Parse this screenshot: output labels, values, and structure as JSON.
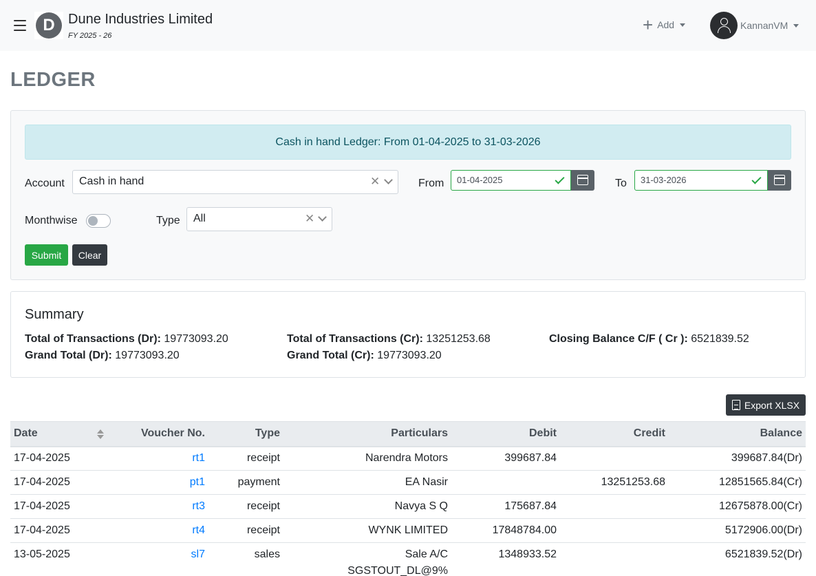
{
  "header": {
    "logo_letter": "D",
    "company_name": "Dune Industries Limited",
    "fiscal_year": "FY 2025 - 26",
    "add_label": "Add",
    "username": "KannanVM"
  },
  "page": {
    "title": "LEDGER"
  },
  "filter": {
    "info_message": "Cash in hand Ledger: From 01-04-2025 to 31-03-2026",
    "account_label": "Account",
    "account_value": "Cash in hand",
    "from_label": "From",
    "from_value": "01-04-2025",
    "to_label": "To",
    "to_value": "31-03-2026",
    "monthwise_label": "Monthwise",
    "monthwise_on": false,
    "type_label": "Type",
    "type_value": "All",
    "submit_label": "Submit",
    "clear_label": "Clear"
  },
  "summary": {
    "title": "Summary",
    "total_dr_label": "Total of Transactions (Dr):",
    "total_dr_value": "19773093.20",
    "grand_dr_label": "Grand Total (Dr):",
    "grand_dr_value": "19773093.20",
    "total_cr_label": "Total of Transactions (Cr):",
    "total_cr_value": "13251253.68",
    "grand_cr_label": "Grand Total (Cr):",
    "grand_cr_value": "19773093.20",
    "closing_label": "Closing Balance C/F ( Cr ):",
    "closing_value": "6521839.52"
  },
  "export": {
    "label": "Export XLSX"
  },
  "table": {
    "headers": {
      "date": "Date",
      "voucher": "Voucher No.",
      "type": "Type",
      "particulars": "Particulars",
      "debit": "Debit",
      "credit": "Credit",
      "balance": "Balance"
    },
    "rows": [
      {
        "date": "17-04-2025",
        "voucher": "rt1",
        "type": "receipt",
        "particulars": "Narendra Motors",
        "particulars2": "",
        "debit": "399687.84",
        "credit": "",
        "balance": "399687.84(Dr)"
      },
      {
        "date": "17-04-2025",
        "voucher": "pt1",
        "type": "payment",
        "particulars": "EA Nasir",
        "particulars2": "",
        "debit": "",
        "credit": "13251253.68",
        "balance": "12851565.84(Cr)"
      },
      {
        "date": "17-04-2025",
        "voucher": "rt3",
        "type": "receipt",
        "particulars": "Navya S Q",
        "particulars2": "",
        "debit": "175687.84",
        "credit": "",
        "balance": "12675878.00(Cr)"
      },
      {
        "date": "17-04-2025",
        "voucher": "rt4",
        "type": "receipt",
        "particulars": "WYNK LIMITED",
        "particulars2": "",
        "debit": "17848784.00",
        "credit": "",
        "balance": "5172906.00(Dr)"
      },
      {
        "date": "13-05-2025",
        "voucher": "sl7",
        "type": "sales",
        "particulars": "Sale A/C",
        "particulars2": "SGSTOUT_DL@9%",
        "debit": "1348933.52",
        "credit": "",
        "balance": "6521839.52(Dr)"
      }
    ]
  }
}
